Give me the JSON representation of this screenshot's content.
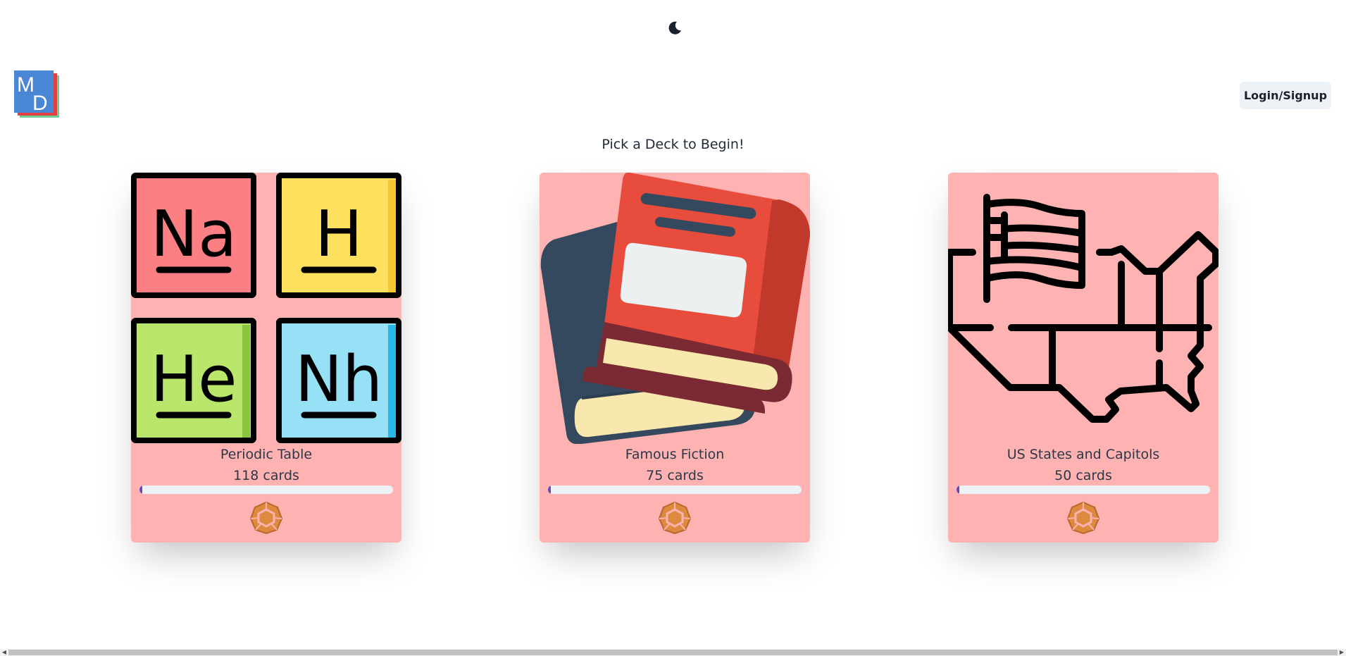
{
  "header": {
    "theme_toggle_icon": "moon-icon",
    "logo_letters": {
      "first": "M",
      "second": "D"
    },
    "login_label": "Login/Signup"
  },
  "main": {
    "heading": "Pick a Deck to Begin!",
    "decks": [
      {
        "name": "Periodic Table",
        "count": "118 cards",
        "progress": 0.01,
        "art": "periodic-table-icon",
        "elements": [
          "Na",
          "H",
          "He",
          "Nh"
        ]
      },
      {
        "name": "Famous Fiction",
        "count": "75 cards",
        "progress": 0.01,
        "art": "books-icon"
      },
      {
        "name": "US States and Capitols",
        "count": "50 cards",
        "progress": 0.01,
        "art": "us-map-flag-icon"
      }
    ],
    "badge_icon": "gem-badge-icon"
  },
  "colors": {
    "card_bg": "#feb2b2",
    "progress_fill": "#6b46c1",
    "progress_track": "#edf2f7",
    "badge": "#dd8a3e",
    "login_bg": "#edf2f7"
  }
}
